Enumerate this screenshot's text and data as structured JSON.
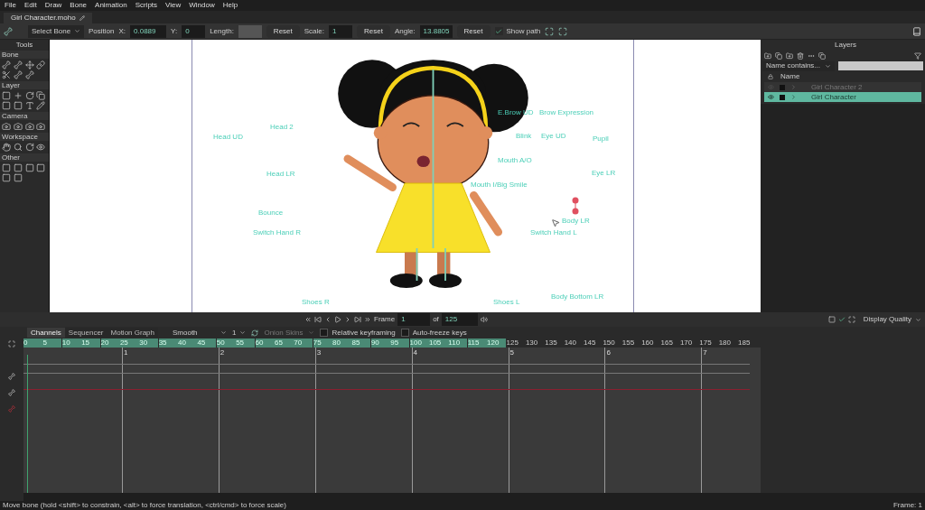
{
  "menu": [
    "File",
    "Edit",
    "Draw",
    "Bone",
    "Animation",
    "Scripts",
    "View",
    "Window",
    "Help"
  ],
  "document_tab": {
    "title": "Girl Character.moho"
  },
  "toolbar": {
    "tool_select": "Select Bone",
    "position_label": "Position",
    "x_label": "X:",
    "x_value": "0.0889",
    "y_label": "Y:",
    "y_value": "0",
    "length_label": "Length:",
    "length_disabled": true,
    "reset_1": "Reset",
    "scale_label": "Scale:",
    "scale_value": "1",
    "reset_2": "Reset",
    "angle_label": "Angle:",
    "angle_value": "13.8805",
    "reset_3": "Reset",
    "show_path": {
      "label": "Show path",
      "checked": true
    }
  },
  "tools": {
    "title": "Tools",
    "sections": [
      "Bone",
      "Layer",
      "Camera",
      "Workspace",
      "Other"
    ]
  },
  "canvas": {
    "bone_labels": [
      {
        "text": "Head UD"
      },
      {
        "text": "Head 2"
      },
      {
        "text": "Head LR"
      },
      {
        "text": "Bounce"
      },
      {
        "text": "Switch Hand R"
      },
      {
        "text": "Shoes R"
      },
      {
        "text": "E.Brow UD"
      },
      {
        "text": "Brow Expression"
      },
      {
        "text": "Blink"
      },
      {
        "text": "Eye UD"
      },
      {
        "text": "Pupil"
      },
      {
        "text": "Mouth A/O"
      },
      {
        "text": "Eye LR"
      },
      {
        "text": "Mouth I/Big Smile"
      },
      {
        "text": "Body LR"
      },
      {
        "text": "Switch Hand L"
      },
      {
        "text": "Shoes L"
      },
      {
        "text": "Body Bottom LR"
      }
    ]
  },
  "playback": {
    "frame_label": "Frame",
    "frame_value": "1",
    "of_label": "of",
    "of_value": "125",
    "display_quality": "Display Quality"
  },
  "timeline": {
    "tabs": [
      {
        "label": "Channels",
        "selected": true
      },
      {
        "label": "Sequencer",
        "selected": false
      },
      {
        "label": "Motion Graph",
        "selected": false
      }
    ],
    "interpolation": "Smooth",
    "step": "1",
    "onion_skins": {
      "label": "Onion Skins",
      "disabled": true
    },
    "relative_keyframing": {
      "label": "Relative keyframing",
      "checked": false
    },
    "auto_freeze": {
      "label": "Auto-freeze keys",
      "checked": false
    },
    "ruler": [
      {
        "label": "0",
        "in_range": true
      },
      {
        "label": "5",
        "in_range": true
      },
      {
        "label": "10",
        "in_range": true
      },
      {
        "label": "15",
        "in_range": true
      },
      {
        "label": "20",
        "in_range": true
      },
      {
        "label": "25",
        "in_range": true
      },
      {
        "label": "30",
        "in_range": true
      },
      {
        "label": "35",
        "in_range": true
      },
      {
        "label": "40",
        "in_range": true
      },
      {
        "label": "45",
        "in_range": true
      },
      {
        "label": "50",
        "in_range": true
      },
      {
        "label": "55",
        "in_range": true
      },
      {
        "label": "60",
        "in_range": true
      },
      {
        "label": "65",
        "in_range": true
      },
      {
        "label": "70",
        "in_range": true
      },
      {
        "label": "75",
        "in_range": true
      },
      {
        "label": "80",
        "in_range": true
      },
      {
        "label": "85",
        "in_range": true
      },
      {
        "label": "90",
        "in_range": true
      },
      {
        "label": "95",
        "in_range": true
      },
      {
        "label": "100",
        "in_range": true
      },
      {
        "label": "105",
        "in_range": true
      },
      {
        "label": "110",
        "in_range": true
      },
      {
        "label": "115",
        "in_range": true
      },
      {
        "label": "120",
        "in_range": true
      },
      {
        "label": "125",
        "in_range": false
      },
      {
        "label": "130",
        "in_range": false
      },
      {
        "label": "135",
        "in_range": false
      },
      {
        "label": "140",
        "in_range": false
      },
      {
        "label": "145",
        "in_range": false
      },
      {
        "label": "150",
        "in_range": false
      },
      {
        "label": "155",
        "in_range": false
      },
      {
        "label": "160",
        "in_range": false
      },
      {
        "label": "165",
        "in_range": false
      },
      {
        "label": "170",
        "in_range": false
      },
      {
        "label": "175",
        "in_range": false
      },
      {
        "label": "180",
        "in_range": false
      },
      {
        "label": "185",
        "in_range": false
      }
    ],
    "seconds": [
      "1",
      "2",
      "3",
      "4",
      "5",
      "6",
      "7"
    ]
  },
  "layers": {
    "title": "Layers",
    "filter": "Name contains...",
    "name_column": "Name",
    "items": [
      {
        "name": "Girl Character 2",
        "selected": false,
        "visible": false
      },
      {
        "name": "Girl Character",
        "selected": true,
        "visible": true
      }
    ]
  },
  "status_bar": {
    "hint": "Move bone (hold <shift> to constrain, <alt> to force translation, <ctrl/cmd> to force scale)",
    "frame": "Frame: 1"
  }
}
